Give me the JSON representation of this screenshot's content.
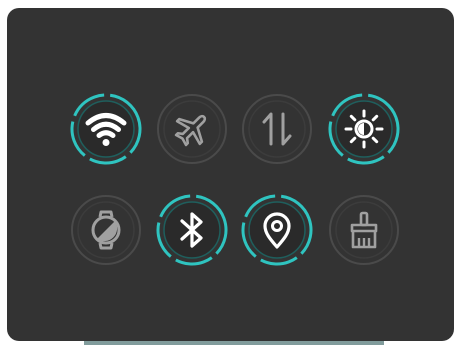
{
  "colors": {
    "panel_bg": "#333333",
    "active_ring": "#2fc4c0",
    "active_glyph": "#ffffff",
    "inactive_ring": "#4a4a4a",
    "inactive_glyph": "#a0a0a0"
  },
  "quick_settings": {
    "rows": [
      [
        {
          "id": "wifi",
          "icon": "wifi-icon",
          "active": true
        },
        {
          "id": "airplane",
          "icon": "airplane-icon",
          "active": false
        },
        {
          "id": "mobile-data",
          "icon": "up-down-arrows-icon",
          "active": false
        },
        {
          "id": "brightness",
          "icon": "brightness-icon",
          "active": true
        }
      ],
      [
        {
          "id": "watch",
          "icon": "watch-icon",
          "active": false
        },
        {
          "id": "bluetooth",
          "icon": "bluetooth-icon",
          "active": true
        },
        {
          "id": "location",
          "icon": "location-pin-icon",
          "active": true
        },
        {
          "id": "cleaner",
          "icon": "brush-icon",
          "active": false
        }
      ]
    ]
  }
}
